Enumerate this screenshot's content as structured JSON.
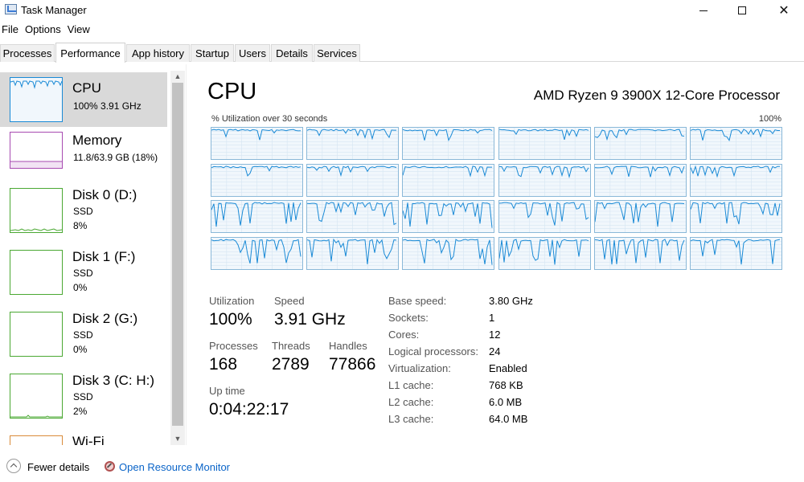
{
  "window": {
    "title": "Task Manager",
    "minimize_icon": "minimize-icon",
    "maximize_icon": "maximize-icon",
    "close_icon": "close-icon"
  },
  "menu": [
    "File",
    "Options",
    "View"
  ],
  "tabs": [
    {
      "label": "Processes",
      "active": false
    },
    {
      "label": "Performance",
      "active": true
    },
    {
      "label": "App history",
      "active": false
    },
    {
      "label": "Startup",
      "active": false
    },
    {
      "label": "Users",
      "active": false
    },
    {
      "label": "Details",
      "active": false
    },
    {
      "label": "Services",
      "active": false
    }
  ],
  "sidebar": {
    "items": [
      {
        "name": "CPU",
        "line1": "100%  3.91 GHz",
        "line2": "",
        "color": "#1a8ad6",
        "selected": true
      },
      {
        "name": "Memory",
        "line1": "11.8/63.9 GB (18%)",
        "line2": "",
        "color": "#a74ab1",
        "selected": false
      },
      {
        "name": "Disk 0 (D:)",
        "line1": "SSD",
        "line2": "8%",
        "color": "#4aa832",
        "selected": false
      },
      {
        "name": "Disk 1 (F:)",
        "line1": "SSD",
        "line2": "0%",
        "color": "#4aa832",
        "selected": false
      },
      {
        "name": "Disk 2 (G:)",
        "line1": "SSD",
        "line2": "0%",
        "color": "#4aa832",
        "selected": false
      },
      {
        "name": "Disk 3 (C: H:)",
        "line1": "SSD",
        "line2": "2%",
        "color": "#4aa832",
        "selected": false
      },
      {
        "name": "Wi-Fi",
        "line1": "",
        "line2": "",
        "color": "#d98b3a",
        "selected": false
      }
    ]
  },
  "cpu": {
    "title": "CPU",
    "model": "AMD Ryzen 9 3900X 12-Core Processor",
    "graph_caption": "% Utilization over 30 seconds",
    "graph_max": "100%",
    "logical_processor_count": 24,
    "graph_color": "#1a8ad6",
    "stats": {
      "utilization_label": "Utilization",
      "utilization": "100%",
      "speed_label": "Speed",
      "speed": "3.91 GHz",
      "processes_label": "Processes",
      "processes": "168",
      "threads_label": "Threads",
      "threads": "2789",
      "handles_label": "Handles",
      "handles": "77866",
      "uptime_label": "Up time",
      "uptime": "0:04:22:17"
    },
    "specs": [
      {
        "label": "Base speed:",
        "value": "3.80 GHz"
      },
      {
        "label": "Sockets:",
        "value": "1"
      },
      {
        "label": "Cores:",
        "value": "12"
      },
      {
        "label": "Logical processors:",
        "value": "24"
      },
      {
        "label": "Virtualization:",
        "value": "Enabled"
      },
      {
        "label": "L1 cache:",
        "value": "768 KB"
      },
      {
        "label": "L2 cache:",
        "value": "6.0 MB"
      },
      {
        "label": "L3 cache:",
        "value": "64.0 MB"
      }
    ]
  },
  "footer": {
    "fewer_details": "Fewer details",
    "open_resource_monitor": "Open Resource Monitor"
  }
}
